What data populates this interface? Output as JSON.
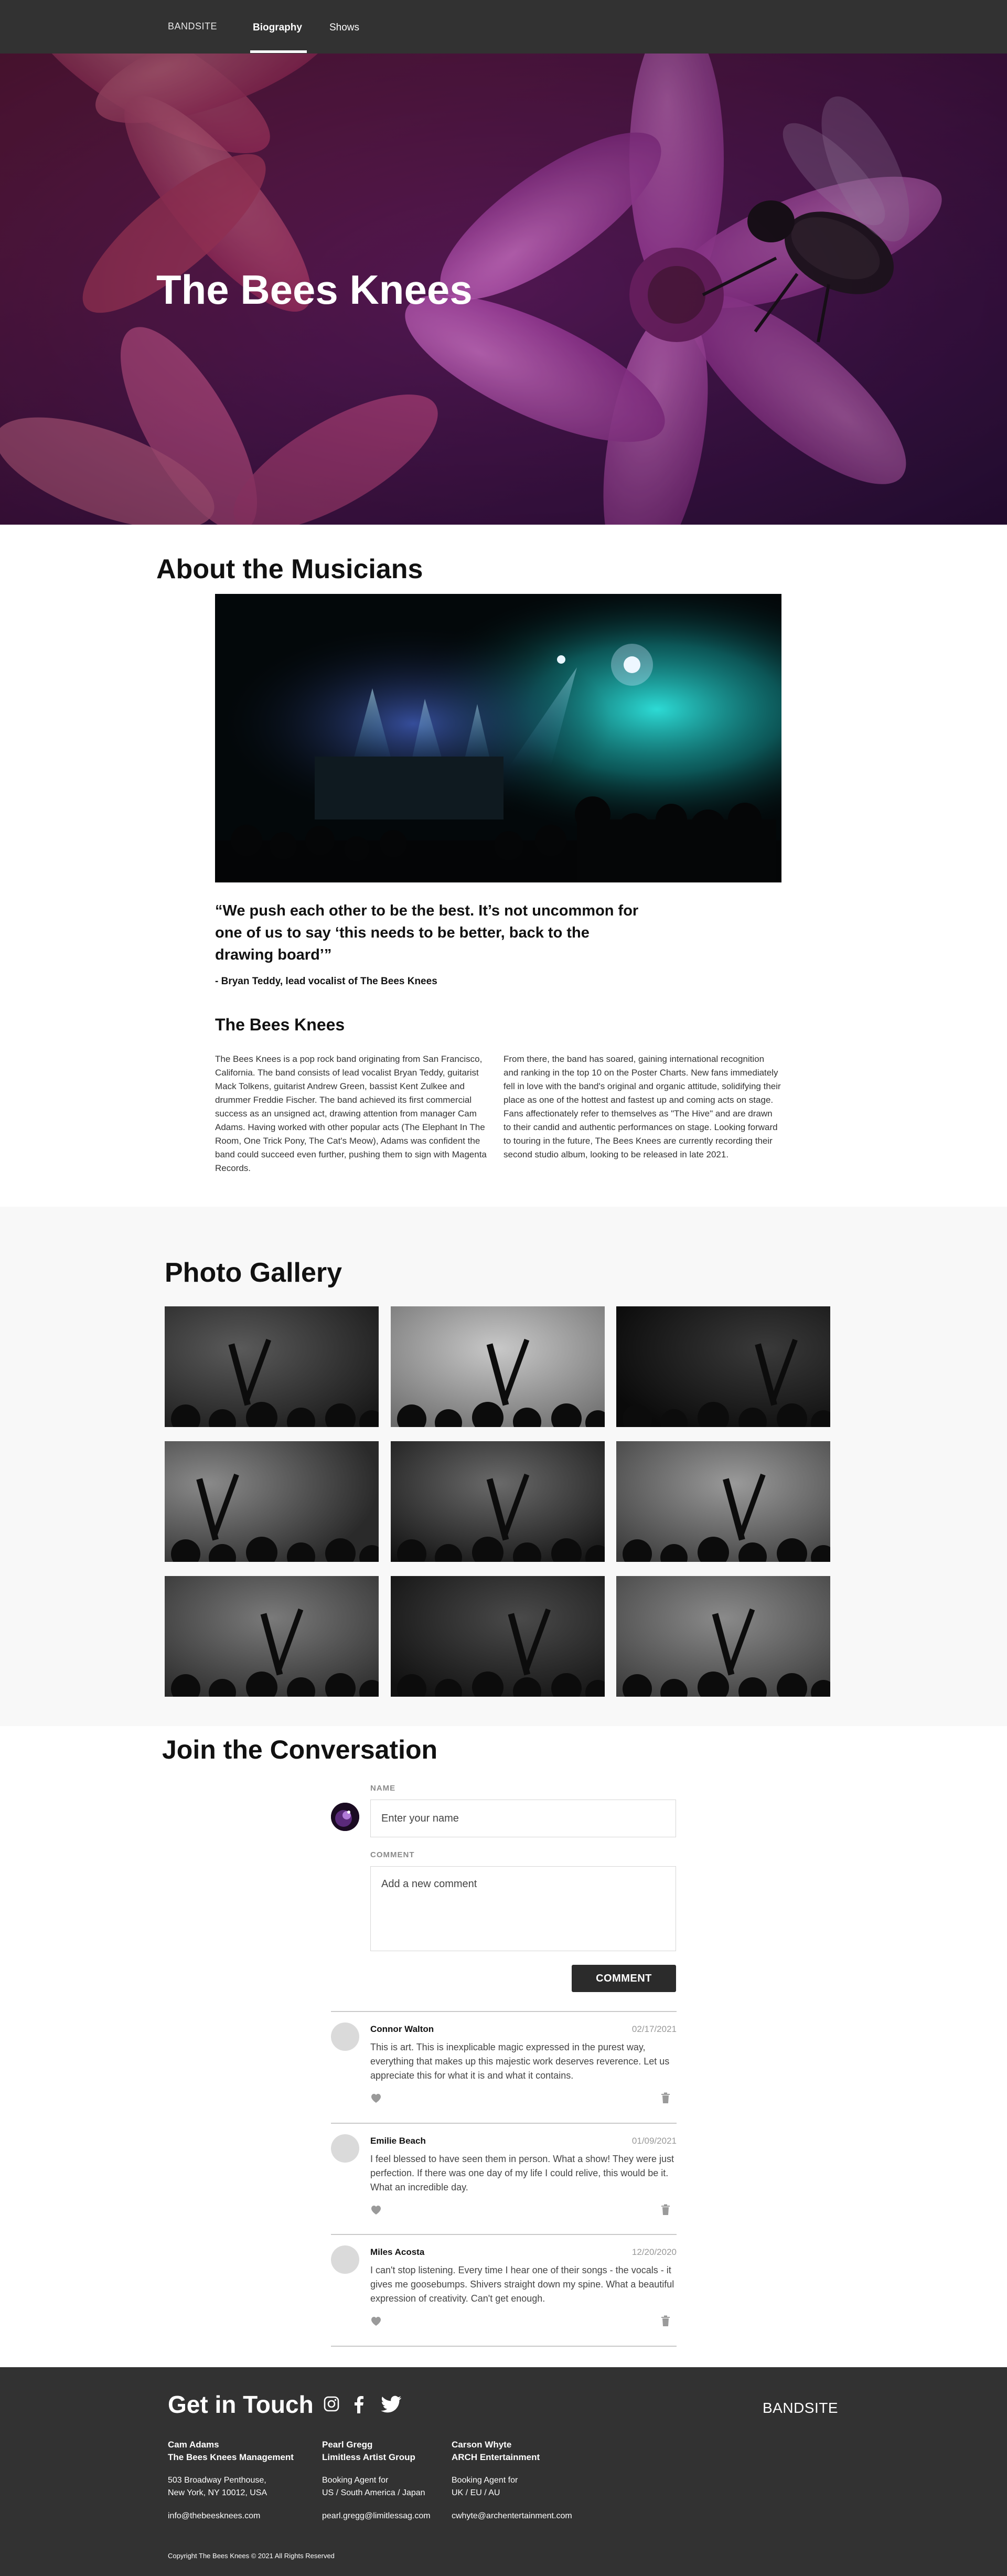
{
  "nav": {
    "brand": "BANDSITE",
    "links": [
      "Biography",
      "Shows"
    ]
  },
  "hero": {
    "title": "The Bees Knees"
  },
  "about": {
    "title": "About the Musicians",
    "quote": "“We push each other to be the best. It’s not uncommon for one of us to say ‘this needs to be better, back to the drawing board’”",
    "quote_attribution": "- Bryan Teddy, lead vocalist of The Bees Knees",
    "bio_title": "The Bees Knees",
    "bio_paragraph_1": "The Bees Knees is a pop rock band originating from San Francisco, California. The band consists of lead vocalist Bryan Teddy, guitarist Mack Tolkens, guitarist Andrew Green, bassist Kent Zulkee and drummer Freddie Fischer. The band achieved its first commercial success as an unsigned act, drawing attention from manager Cam Adams. Having worked with other popular acts (The Elephant In The Room, One Trick Pony, The Cat's Meow), Adams was confident the band could succeed even further, pushing them to sign with Magenta Records.",
    "bio_paragraph_2": "From there, the band has soared, gaining international recognition and ranking in the top 10 on the Poster Charts. New fans immediately fell in love with the band's original and organic attitude, solidifying their place as one of the hottest and fastest up and coming acts on stage. Fans affectionately refer to themselves as \"The Hive\" and are drawn to their candid and authentic performances on stage. Looking forward to touring in the future, The Bees Knees are currently recording their second studio album, looking to be released in late 2021."
  },
  "gallery": {
    "title": "Photo Gallery"
  },
  "conversation": {
    "title": "Join the Conversation",
    "name_label": "NAME",
    "name_placeholder": "Enter your name",
    "comment_label": "COMMENT",
    "comment_placeholder": "Add a new comment",
    "button_label": "COMMENT",
    "comments": [
      {
        "name": "Connor Walton",
        "date": "02/17/2021",
        "text": "This is art. This is inexplicable magic expressed in the purest way, everything that makes up this majestic work deserves reverence. Let us appreciate this for what it is and what it contains."
      },
      {
        "name": "Emilie Beach",
        "date": "01/09/2021",
        "text": "I feel blessed to have seen them in person. What a show! They were just perfection. If there was one day of my life I could relive, this would be it. What an incredible day."
      },
      {
        "name": "Miles Acosta",
        "date": "12/20/2020",
        "text": "I can't stop listening. Every time I hear one of their songs - the vocals - it gives me goosebumps. Shivers straight down my spine. What a beautiful expression of creativity. Can't get enough."
      }
    ]
  },
  "footer": {
    "title": "Get in Touch",
    "brand": "BANDSITE",
    "contacts": [
      {
        "name": "Cam Adams",
        "org": "The Bees Knees Management",
        "line1": "503 Broadway Penthouse,",
        "line2": "New York, NY 10012, USA",
        "email": "info@thebeesknees.com"
      },
      {
        "name": "Pearl Gregg",
        "org": "Limitless Artist Group",
        "line1": "Booking Agent for",
        "line2": "US / South America / Japan",
        "email": "pearl.gregg@limitlessag.com"
      },
      {
        "name": "Carson Whyte",
        "org": "ARCH Entertainment",
        "line1": "Booking Agent for",
        "line2": "UK / EU / AU",
        "email": "cwhyte@archentertainment.com"
      }
    ],
    "copyright": "Copyright The Bees Knees © 2021 All Rights Reserved"
  },
  "icons": {
    "social": [
      "instagram-icon",
      "facebook-icon",
      "twitter-icon"
    ],
    "comment_actions": [
      "heart-icon",
      "trash-icon"
    ]
  },
  "colors": {
    "nav_bg": "#323232",
    "footer_bg": "#323232",
    "gallery_bg": "#f8f8f8",
    "button_bg": "#2b2b2b",
    "hero_tint": "#b33aa8"
  }
}
